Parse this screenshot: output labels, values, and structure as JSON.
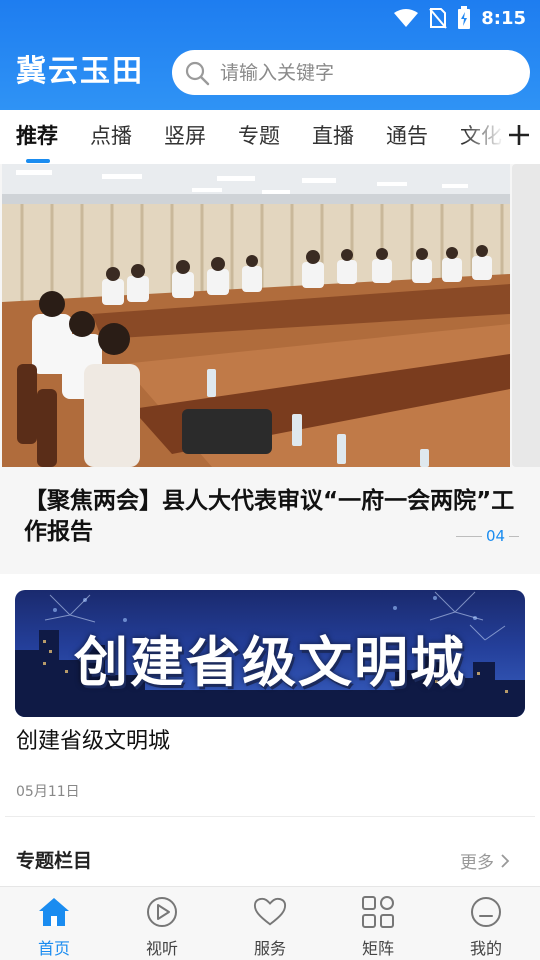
{
  "status": {
    "time": "8:15"
  },
  "header": {
    "brand": "冀云玉田"
  },
  "search": {
    "placeholder": "请输入关键字"
  },
  "tabs": [
    {
      "label": "推荐",
      "active": true
    },
    {
      "label": "点播"
    },
    {
      "label": "竖屏"
    },
    {
      "label": "专题"
    },
    {
      "label": "直播"
    },
    {
      "label": "通告"
    },
    {
      "label": "文化"
    }
  ],
  "feature": {
    "title": "【聚焦两会】县人大代表审议“一府一会两院”工作报告",
    "page": "04"
  },
  "article": {
    "banner_text": "创建省级文明城",
    "title": "创建省级文明城",
    "date": "05月11日"
  },
  "section": {
    "title": "专题栏目",
    "more": "更多"
  },
  "bottom_nav": [
    {
      "label": "首页",
      "icon": "home-icon",
      "active": true
    },
    {
      "label": "视听",
      "icon": "play-icon"
    },
    {
      "label": "服务",
      "icon": "heart-icon"
    },
    {
      "label": "矩阵",
      "icon": "grid-icon"
    },
    {
      "label": "我的",
      "icon": "profile-icon"
    }
  ],
  "colors": {
    "accent": "#1a8cf0",
    "header": "#2389f2"
  }
}
